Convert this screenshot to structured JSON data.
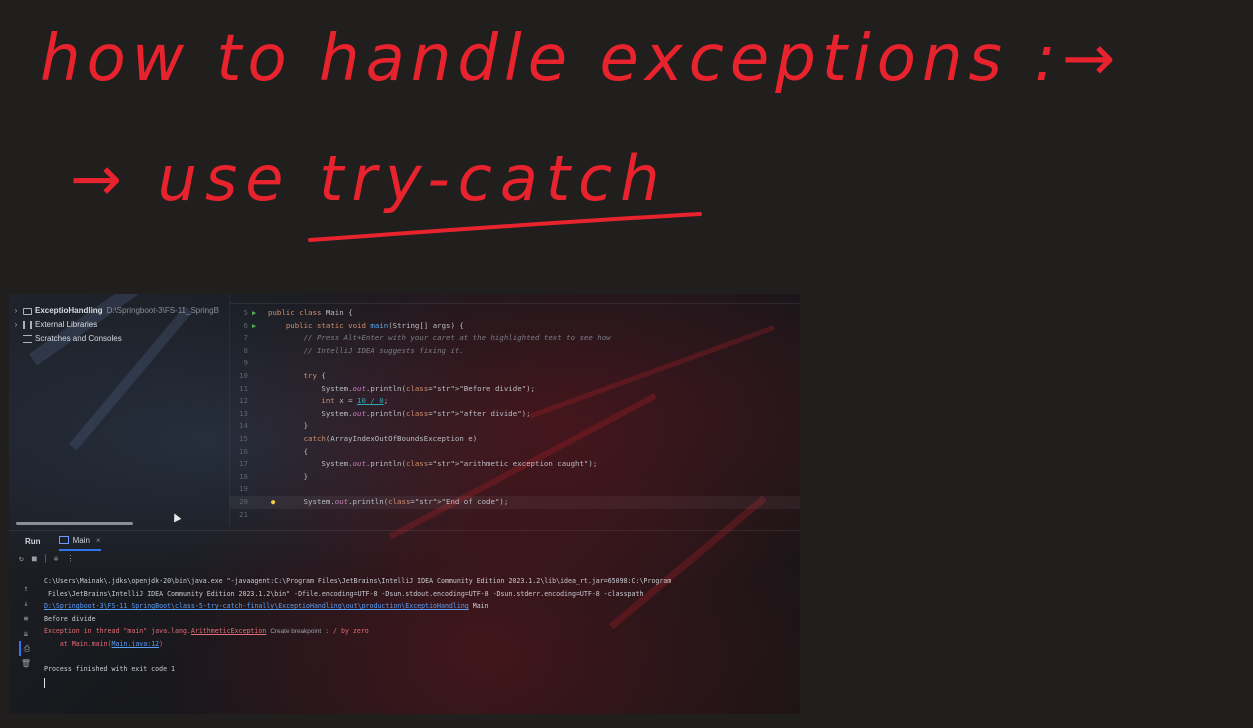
{
  "handwriting": {
    "line1": "how to handle exceptions :→",
    "line2": "→ use try-catch",
    "ink_color": "#e8232e"
  },
  "project_tree": {
    "items": [
      {
        "label": "ExceptioHandling",
        "path": "D:\\Springboot-3\\FS-11_SpringB",
        "icon": "folder-icon"
      },
      {
        "label": "External Libraries",
        "icon": "library-icon"
      },
      {
        "label": "Scratches and Consoles",
        "icon": "scratches-icon"
      }
    ]
  },
  "editor": {
    "lines": [
      {
        "n": "5",
        "text": "public class Main {"
      },
      {
        "n": "6",
        "text": "    public static void main(String[] args) {"
      },
      {
        "n": "7",
        "text": "        // Press Alt+Enter with your caret at the highlighted text to see how"
      },
      {
        "n": "8",
        "text": "        // IntelliJ IDEA suggests fixing it."
      },
      {
        "n": "9",
        "text": ""
      },
      {
        "n": "10",
        "text": "        try {"
      },
      {
        "n": "11",
        "text": "            System.out.println(\"Before divide\");"
      },
      {
        "n": "12",
        "text": "            int x = 10 / 0;"
      },
      {
        "n": "13",
        "text": "            System.out.println(\"after divide\");"
      },
      {
        "n": "14",
        "text": "        }"
      },
      {
        "n": "15",
        "text": "        catch(ArrayIndexOutOfBoundsException e)"
      },
      {
        "n": "16",
        "text": "        {"
      },
      {
        "n": "17",
        "text": "            System.out.println(\"arithmetic exception caught\");"
      },
      {
        "n": "18",
        "text": "        }"
      },
      {
        "n": "19",
        "text": ""
      },
      {
        "n": "20",
        "text": "        System.out.println(\"End of code\");"
      },
      {
        "n": "21",
        "text": ""
      }
    ]
  },
  "run_panel": {
    "title": "Run",
    "tab_label": "Main",
    "console": {
      "cmd1": "C:\\Users\\Mainak\\.jdks\\openjdk-20\\bin\\java.exe \"-javaagent:C:\\Program Files\\JetBrains\\IntelliJ IDEA Community Edition 2023.1.2\\lib\\idea_rt.jar=65098:C:\\Program",
      "cmd2": " Files\\JetBrains\\IntelliJ IDEA Community Edition 2023.1.2\\bin\" -Dfile.encoding=UTF-8 -Dsun.stdout.encoding=UTF-8 -Dsun.stderr.encoding=UTF-8 -classpath",
      "cmd3_link": "D:\\Springboot-3\\FS-11_SpringBoot\\class-5-try-catch-finally\\ExceptioHandling\\out\\production\\ExceptioHandling",
      "cmd3_rest": " Main",
      "out1": "Before divide",
      "err_prefix": "Exception in thread \"main\" java.lang.",
      "err_class": "ArithmeticException",
      "err_hint": "Create breakpoint",
      "err_suffix": " : / by zero",
      "trace_prefix": "    at Main.main(",
      "trace_link": "Main.java:12",
      "trace_suffix": ")",
      "exit": "Process finished with exit code 1"
    }
  }
}
